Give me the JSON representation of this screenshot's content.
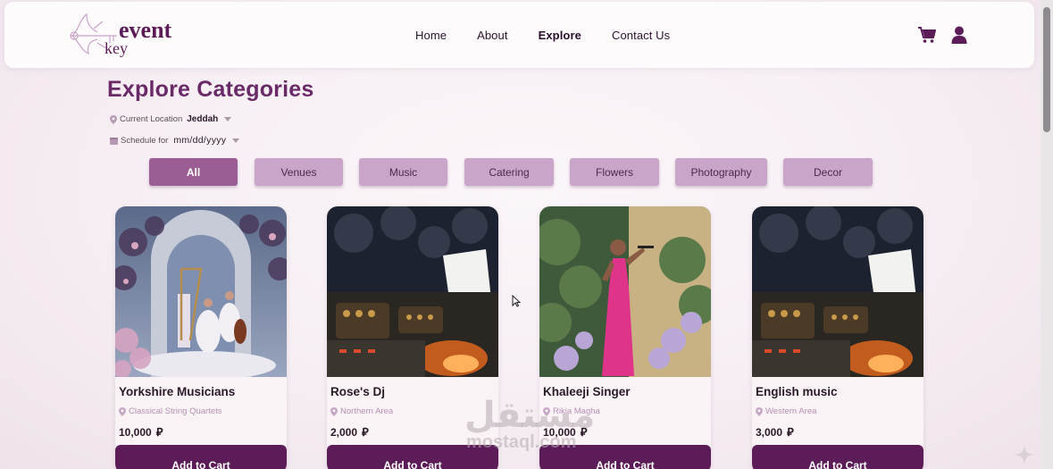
{
  "header": {
    "logo_text_top": "event",
    "logo_text_bottom": "key",
    "nav": [
      {
        "label": "Home",
        "active": false
      },
      {
        "label": "About",
        "active": false
      },
      {
        "label": "Explore",
        "active": true
      },
      {
        "label": "Contact Us",
        "active": false
      }
    ],
    "icons": [
      "cart-icon",
      "user-icon"
    ]
  },
  "page": {
    "title": "Explore Categories",
    "location_label": "Current Location",
    "location_value": "Jeddah",
    "schedule_label": "Schedule for",
    "schedule_placeholder": "mm/dd/yyyy"
  },
  "categories": [
    {
      "label": "All",
      "active": true
    },
    {
      "label": "Venues",
      "active": false
    },
    {
      "label": "Music",
      "active": false
    },
    {
      "label": "Catering",
      "active": false
    },
    {
      "label": "Flowers",
      "active": false
    },
    {
      "label": "Photography",
      "active": false
    },
    {
      "label": "Decor",
      "active": false
    }
  ],
  "cards": [
    {
      "name": "Yorkshire Musicians",
      "area": "Classical String Quartets",
      "price": "10,000",
      "button": "Add to Cart",
      "image": "string-quartet-photo"
    },
    {
      "name": "Rose's Dj",
      "area": "Northern Area",
      "price": "2,000",
      "button": "Add to Cart",
      "image": "dj-mixer-photo"
    },
    {
      "name": "Khaleeji Singer",
      "area": "Rikia Magha",
      "price": "10,000",
      "button": "Add to Cart",
      "image": "singer-photo"
    },
    {
      "name": "English music",
      "area": "Western Area",
      "price": "3,000",
      "button": "Add to Cart",
      "image": "dj-mixer-photo"
    }
  ],
  "currency_symbol": "⃁",
  "watermark": {
    "arabic": "مستقل",
    "latin": "mostaql.com"
  },
  "colors": {
    "brand": "#6a2a68",
    "button": "#5c1c58",
    "tab": "#c8a5c9",
    "tab_active": "#9a5e95"
  }
}
